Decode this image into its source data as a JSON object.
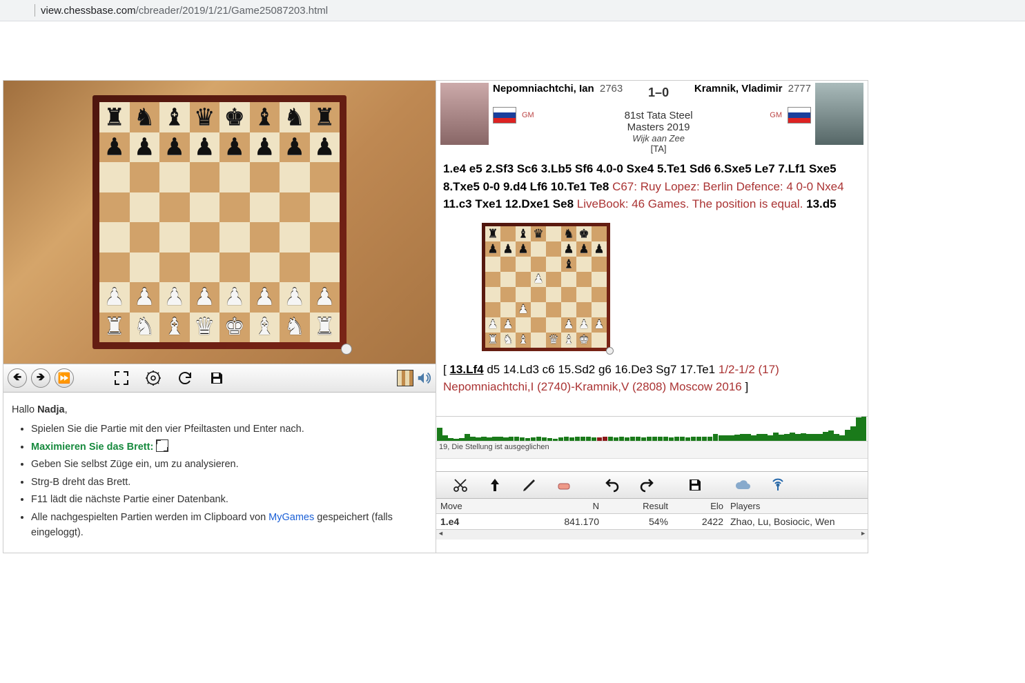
{
  "browser": {
    "url_host": "view.chessbase.com",
    "url_path": "/cbreader/2019/1/21/Game25087203.html"
  },
  "hints": {
    "greeting_prefix": "Hallo ",
    "greeting_name": "Nadja",
    "greeting_suffix": ",",
    "li1": "Spielen Sie die Partie mit den vier Pfeiltasten und Enter nach.",
    "li2": "Maximieren Sie das Brett: ",
    "li3": "Geben Sie selbst Züge ein, um zu analysieren.",
    "li4": "Strg-B dreht das Brett.",
    "li5": "F11 lädt die nächste Partie einer Datenbank.",
    "li6_pre": "Alle nachgespielten Partien werden im Clipboard von ",
    "li6_link": "MyGames",
    "li6_post": " gespeichert (falls eingeloggt)."
  },
  "white": {
    "name": "Nepomniachtchi, Ian",
    "rating": "2763",
    "title": "GM"
  },
  "black": {
    "name": "Kramnik, Vladimir",
    "rating": "2777",
    "title": "GM"
  },
  "game": {
    "result": "1–0",
    "event": "81st Tata Steel Masters 2019",
    "location": "Wijk aan Zee",
    "annotator": "[TA]"
  },
  "moves": {
    "main1": "1.e4 e5 2.Sf3 Sc6 3.Lb5 Sf6 4.0-0 Sxe4 5.Te1 Sd6 6.Sxe5 Le7 7.Lf1 Sxe5 8.Txe5 0-0 9.d4 Lf6 10.Te1 Te8",
    "eco": "C67: Ruy Lopez: Berlin Defence: 4 0-0 Nxe4",
    "main2": "11.c3 Txe1 12.Dxe1 Se8",
    "book": "LiveBook: 46 Games. The position is equal.",
    "main3": "13.d5",
    "var_open": "[ ",
    "var_mv": "13.Lf4",
    "var_rest": " d5 14.Ld3 c6 15.Sd2 g6 16.De3 Sg7 17.Te1 ",
    "var_res": "1/2-1/2 (17) Nepomniachtchi,I (2740)-Kramnik,V (2808) Moscow 2016",
    "var_close": " ]"
  },
  "eval_status": "19, Die Stellung ist ausgeglichen",
  "book_table": {
    "h1": "Move",
    "h2": "N",
    "h3": "Result",
    "h4": "Elo",
    "h5": "Players",
    "r": {
      "move": "1.e4",
      "n": "841.170",
      "res": "54%",
      "elo": "2422",
      "players": "Zhao, Lu, Bosiocic, Wen"
    }
  },
  "pos_main": [
    "r",
    "n",
    "b",
    "q",
    "k",
    "b",
    "n",
    "r",
    "p",
    "p",
    "p",
    "p",
    "p",
    "p",
    "p",
    "p",
    "",
    "",
    "",
    "",
    "",
    "",
    "",
    "",
    "",
    "",
    "",
    "",
    "",
    "",
    "",
    "",
    "",
    "",
    "",
    "",
    "",
    "",
    "",
    "",
    "",
    "",
    "",
    "",
    "",
    "",
    "",
    "",
    "P",
    "P",
    "P",
    "P",
    "P",
    "P",
    "P",
    "P",
    "R",
    "N",
    "B",
    "Q",
    "K",
    "B",
    "N",
    "R"
  ],
  "pos_mini": [
    "r",
    "",
    "b",
    "q",
    "",
    "n",
    "k",
    "",
    "p",
    "p",
    "p",
    "",
    "",
    "p",
    "p",
    "p",
    "",
    "",
    "",
    "",
    "",
    "b",
    "",
    "",
    "",
    "",
    "",
    "P",
    "",
    "",
    "",
    "",
    "",
    "",
    "",
    "",
    "",
    "",
    "",
    "",
    "",
    "",
    "P",
    "",
    "",
    "",
    "",
    "",
    "P",
    "P",
    "",
    "",
    "",
    "P",
    "P",
    "P",
    "R",
    "N",
    "B",
    "",
    "Q",
    "B",
    "K",
    ""
  ],
  "eval_bars": [
    54,
    24,
    12,
    10,
    12,
    30,
    16,
    14,
    16,
    14,
    18,
    16,
    14,
    16,
    16,
    14,
    12,
    14,
    16,
    14,
    12,
    8,
    14,
    16,
    14,
    16,
    18,
    16,
    14,
    14,
    16,
    16,
    14,
    18,
    14,
    16,
    17,
    14,
    18,
    16,
    18,
    16,
    14,
    18,
    16,
    14,
    18,
    16,
    16,
    18,
    30,
    24,
    22,
    24,
    26,
    28,
    30,
    24,
    28,
    30,
    24,
    34,
    26,
    30,
    34,
    28,
    32,
    30,
    30,
    30,
    36,
    42,
    30,
    24,
    46,
    60,
    96,
    100
  ]
}
